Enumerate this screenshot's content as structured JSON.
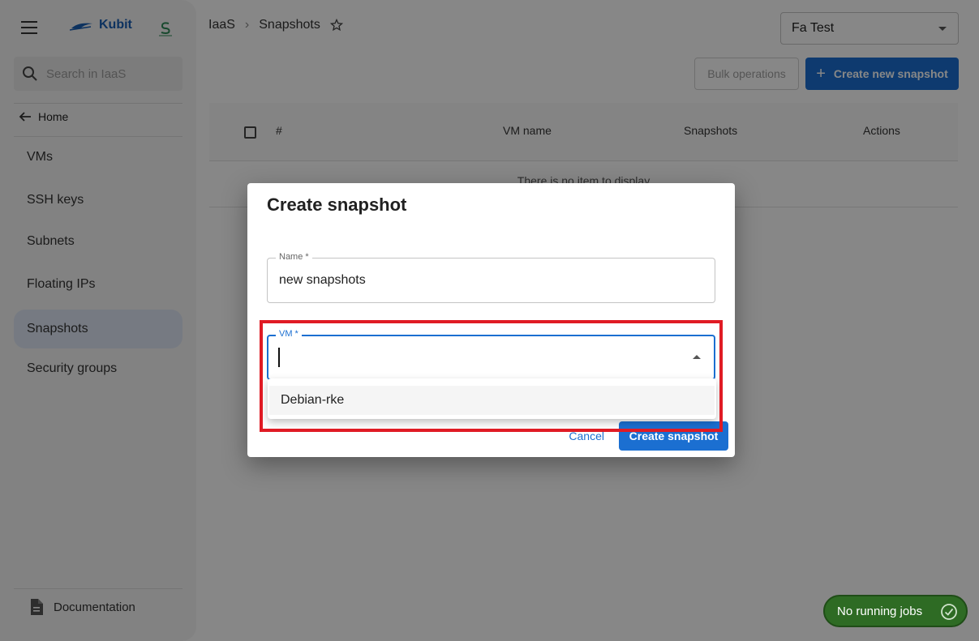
{
  "sidebar": {
    "brand": "Kubit",
    "search_placeholder": "Search in IaaS",
    "home_label": "Home",
    "items": [
      {
        "label": "VMs"
      },
      {
        "label": "SSH keys"
      },
      {
        "label": "Subnets"
      },
      {
        "label": "Floating IPs"
      },
      {
        "label": "Snapshots",
        "active": true
      },
      {
        "label": "Security groups"
      }
    ],
    "documentation_label": "Documentation"
  },
  "header": {
    "breadcrumb": [
      "IaaS",
      "Snapshots"
    ],
    "tenant": "Fa Test",
    "bulk_label": "Bulk operations",
    "create_label": "Create new snapshot"
  },
  "table": {
    "columns": [
      "#",
      "VM name",
      "Snapshots",
      "Actions"
    ],
    "empty_text": "There is no item to display"
  },
  "dialog": {
    "title": "Create snapshot",
    "name_label": "Name *",
    "name_value": "new snapshots",
    "vm_label": "VM *",
    "vm_value": "",
    "vm_options": [
      "Debian-rke"
    ],
    "cancel_label": "Cancel",
    "submit_label": "Create snapshot"
  },
  "jobs": {
    "label": "No running jobs"
  },
  "colors": {
    "primary": "#1b6fd1",
    "highlight": "#e01b24",
    "jobs_bg": "#2e6b24"
  }
}
